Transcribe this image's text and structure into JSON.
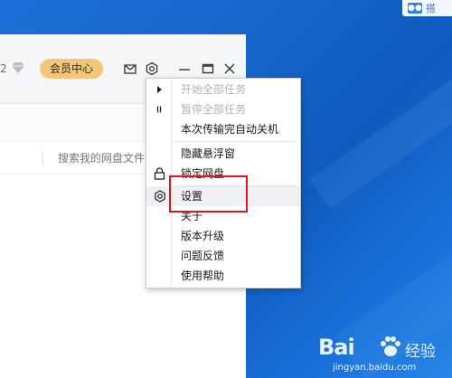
{
  "desktop": {
    "widget_text": "搭"
  },
  "app": {
    "user_level_fragment": "2",
    "vip_label": "会员中心",
    "search_placeholder": "搜索我的网盘文件"
  },
  "context_menu": {
    "items": [
      {
        "label": "开始全部任务",
        "disabled": true,
        "icon": "play-icon"
      },
      {
        "label": "暂停全部任务",
        "disabled": true,
        "icon": "pause-icon"
      },
      {
        "label": "本次传输完自动关机",
        "disabled": false
      },
      {
        "label": "隐藏悬浮窗",
        "disabled": false
      },
      {
        "label": "锁定网盘",
        "disabled": false,
        "icon": "lock-icon"
      },
      {
        "label": "设置",
        "disabled": false,
        "icon": "gear-icon",
        "highlighted": true
      },
      {
        "label": "关于",
        "disabled": false
      },
      {
        "label": "版本升级",
        "disabled": false
      },
      {
        "label": "问题反馈",
        "disabled": false
      },
      {
        "label": "使用帮助",
        "disabled": false
      }
    ]
  },
  "watermark": {
    "logo_text": "Bai",
    "cn_text": "经验",
    "url": "jingyan.baidu.com"
  },
  "colors": {
    "desktop": "#1565c9",
    "vip_badge": "#f3c77a",
    "highlight": "#e3141b"
  }
}
